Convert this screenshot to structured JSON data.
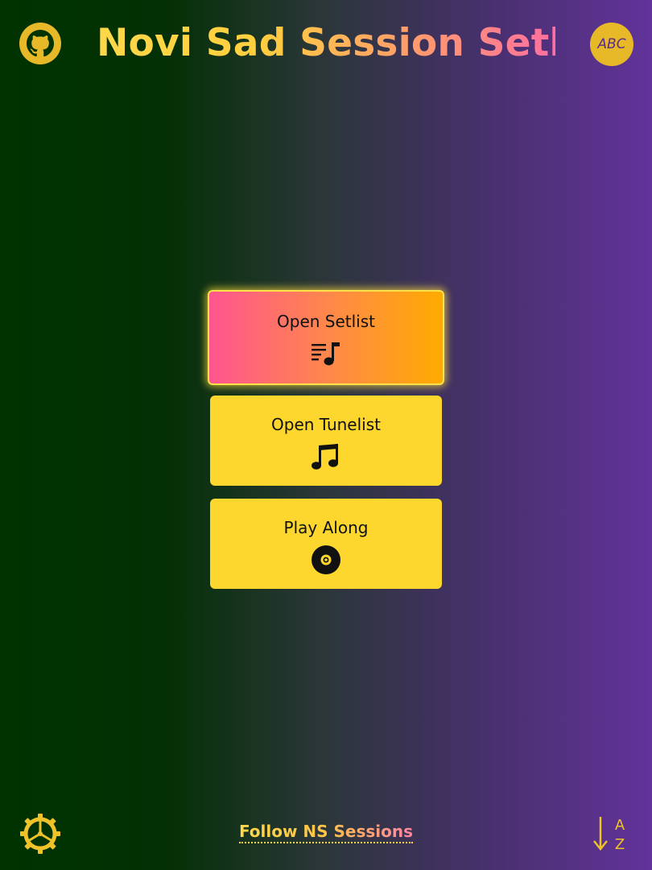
{
  "header": {
    "title": "Novi Sad Session Setlist",
    "abc_label": "ABC",
    "github_icon": "github-icon"
  },
  "menu": {
    "items": [
      {
        "label": "Open Setlist",
        "icon": "playlist-music-icon",
        "active": true
      },
      {
        "label": "Open Tunelist",
        "icon": "music-notes-icon",
        "active": false
      },
      {
        "label": "Play Along",
        "icon": "vinyl-record-icon",
        "active": false
      }
    ]
  },
  "footer": {
    "settings_icon": "gear-icon",
    "follow_label": "Follow NS Sessions",
    "sort_icon": "sort-az-icon"
  },
  "colors": {
    "accent_yellow": "#fdd62e",
    "active_gradient_start": "#ff5590",
    "active_gradient_end": "#ffab00",
    "bg_left": "#003300",
    "bg_right": "#62339a"
  }
}
